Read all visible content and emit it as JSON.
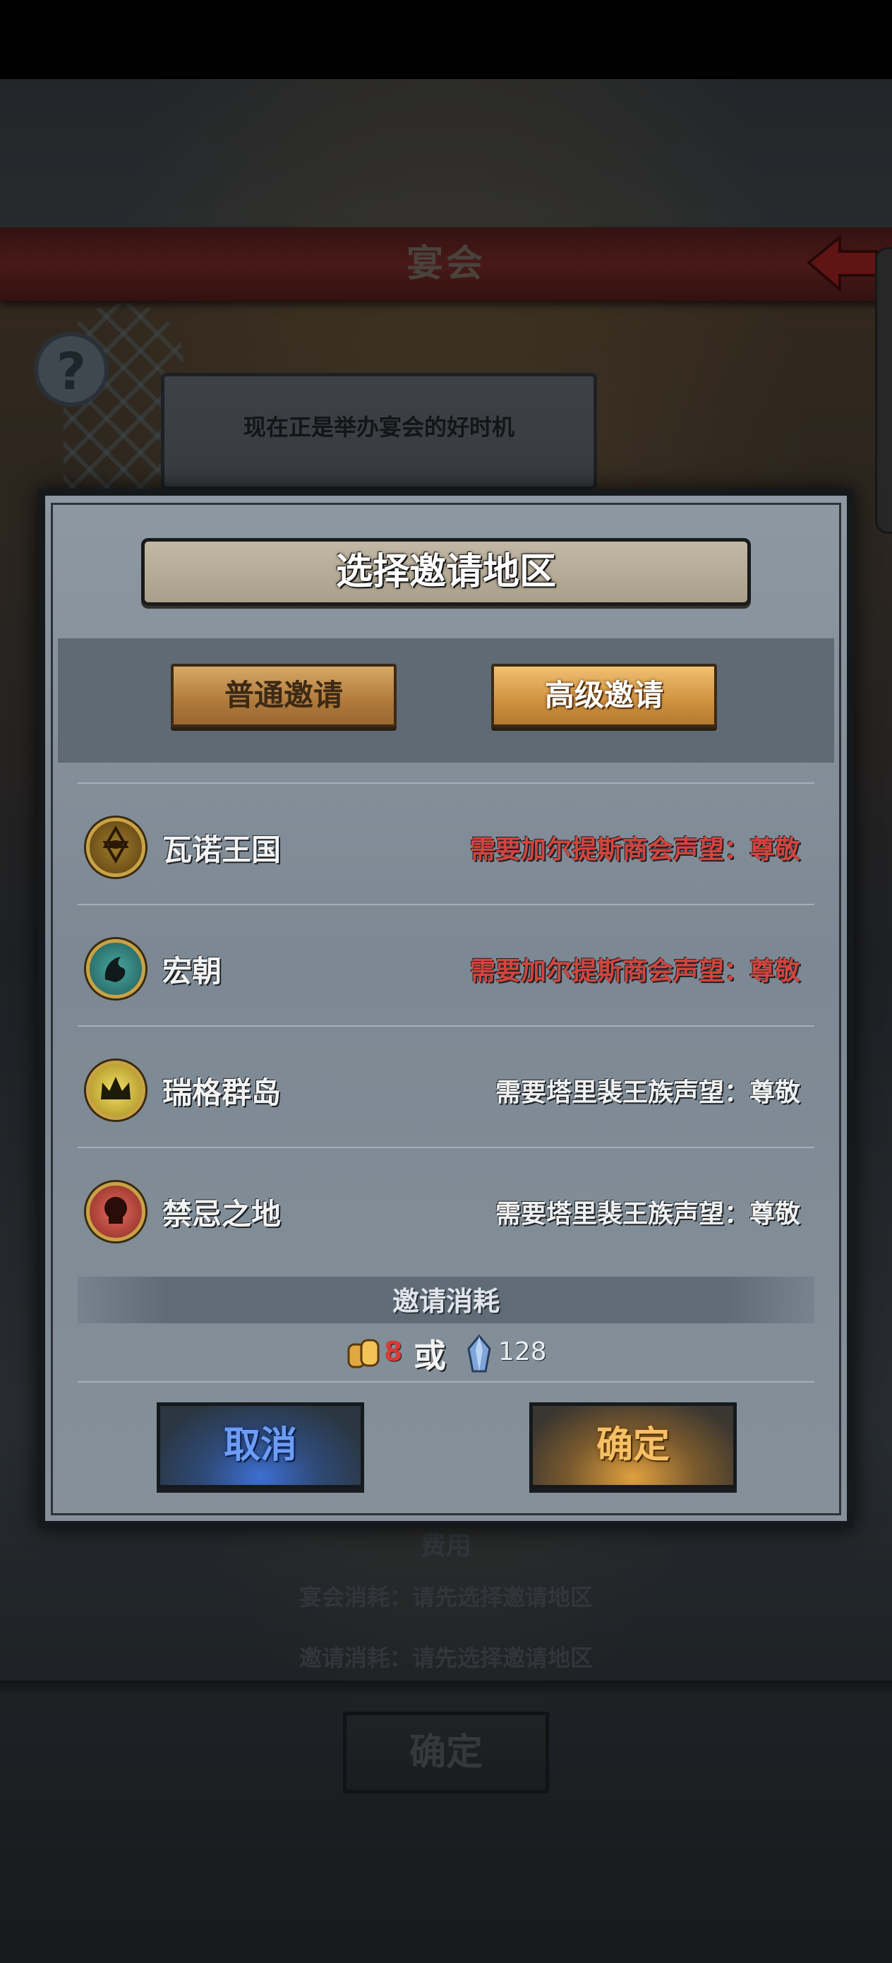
{
  "header": {
    "title": "宴会"
  },
  "background": {
    "hint": "现在正是举办宴会的好时机",
    "fee_label": "费用",
    "feast_cost": "宴会消耗：请先选择邀请地区",
    "invite_cost": "邀请消耗：请先选择邀请地区",
    "confirm_label": "确定"
  },
  "modal": {
    "title": "选择邀请地区",
    "tabs": [
      {
        "label": "普通邀请",
        "selected": false
      },
      {
        "label": "高级邀请",
        "selected": true
      }
    ],
    "regions": [
      {
        "name": "瓦诺王国",
        "requirement": "需要加尔提斯商会声望：尊敬",
        "requirement_met": false,
        "emblem_icon": "eye-hexagram-emblem",
        "emblem_color": "#d9b24a"
      },
      {
        "name": "宏朝",
        "requirement": "需要加尔提斯商会声望：尊敬",
        "requirement_met": false,
        "emblem_icon": "dragon-emblem",
        "emblem_color": "#2f8f8a"
      },
      {
        "name": "瑞格群岛",
        "requirement": "需要塔里裴王族声望：尊敬",
        "requirement_met": true,
        "emblem_icon": "crown-emblem",
        "emblem_color": "#e3c640"
      },
      {
        "name": "禁忌之地",
        "requirement": "需要塔里裴王族声望：尊敬",
        "requirement_met": true,
        "emblem_icon": "skull-emblem",
        "emblem_color": "#d4443b"
      }
    ],
    "cost": {
      "title": "邀请消耗",
      "food_amount": "8",
      "or_text": "或",
      "gem_amount": "128"
    },
    "cancel_label": "取消",
    "confirm_label": "确定"
  },
  "colors": {
    "requirement_unmet": "#d2453f",
    "requirement_met": "#f0f0f0",
    "title_bar": "#6a2723"
  }
}
